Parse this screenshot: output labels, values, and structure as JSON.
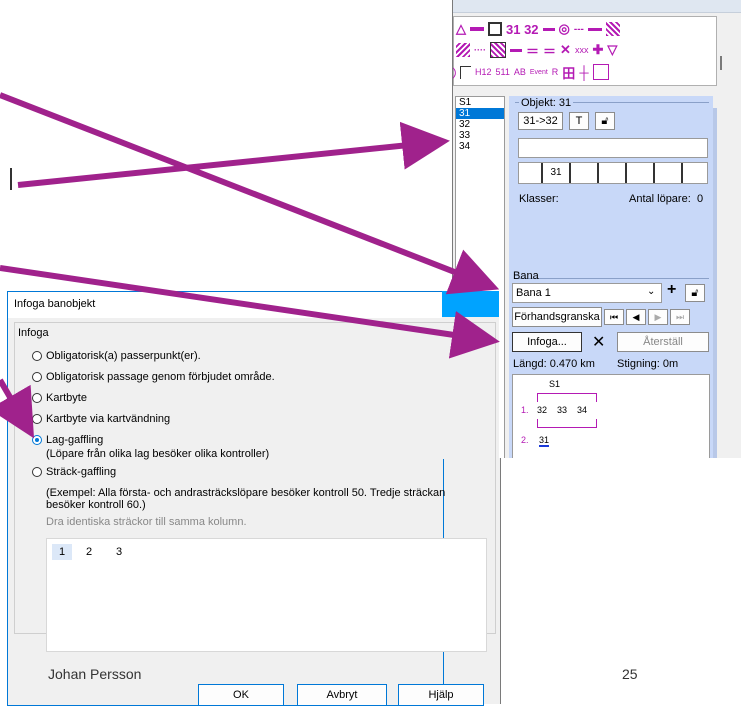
{
  "panel": {
    "symbols": {
      "row1_numbers": "31 32",
      "row3_labels": [
        "H12",
        "511",
        "AB",
        "Event",
        "R"
      ]
    },
    "control_list": [
      "S1",
      "31",
      "32",
      "33",
      "34"
    ],
    "control_list_selected": "31",
    "object_label": "Objekt: 31",
    "leg_button": "31->32",
    "t_button": "T",
    "course_cells": [
      "",
      "31",
      "",
      "",
      "",
      "",
      ""
    ],
    "classes_label": "Klasser:",
    "runners_label": "Antal löpare:",
    "runners_count": "0",
    "course_section_label": "Bana",
    "course_select_value": "Bana 1",
    "preview_button": "Förhandsgranska",
    "insert_button": "Infoga...",
    "restore_button": "Återställ",
    "length_text": "Längd: 0.470 km",
    "climb_text": "Stigning: 0m",
    "preview": {
      "start": "S1",
      "row1_num": "1.",
      "row1_controls": [
        "32",
        "33",
        "34"
      ],
      "row2_num": "2.",
      "row2_control": "31"
    }
  },
  "dialog": {
    "title": "Infoga banobjekt",
    "group_label": "Infoga",
    "options": [
      {
        "label": "Obligatorisk(a) passerpunkt(er).",
        "selected": false
      },
      {
        "label": "Obligatorisk passage genom förbjudet område.",
        "selected": false
      },
      {
        "label": "Kartbyte",
        "selected": false
      },
      {
        "label": "Kartbyte via kartvändning",
        "selected": false
      },
      {
        "label": "Lag-gaffling",
        "selected": true
      },
      {
        "label": "Sträck-gaffling",
        "selected": false
      }
    ],
    "lag_description": "(Löpare från olika lag besöker olika kontroller)",
    "strack_example_1": "(Exempel: Alla första- och andrasträckslöpare besöker kontroll 50. Tredje sträckan",
    "strack_example_2": "besöker kontroll 60.)",
    "drag_hint": "Dra identiska sträckor till samma kolumn.",
    "columns": [
      "1",
      "2",
      "3"
    ],
    "ok_button": "OK",
    "cancel_button": "Avbryt",
    "help_button": "Hjälp"
  },
  "footer": {
    "author": "Johan Persson",
    "page_number": "25"
  },
  "colors": {
    "arrow": "#a0228c",
    "accent": "#0078d7",
    "symbol": "#b41ab4",
    "panel_bg": "#c8d8f8"
  }
}
